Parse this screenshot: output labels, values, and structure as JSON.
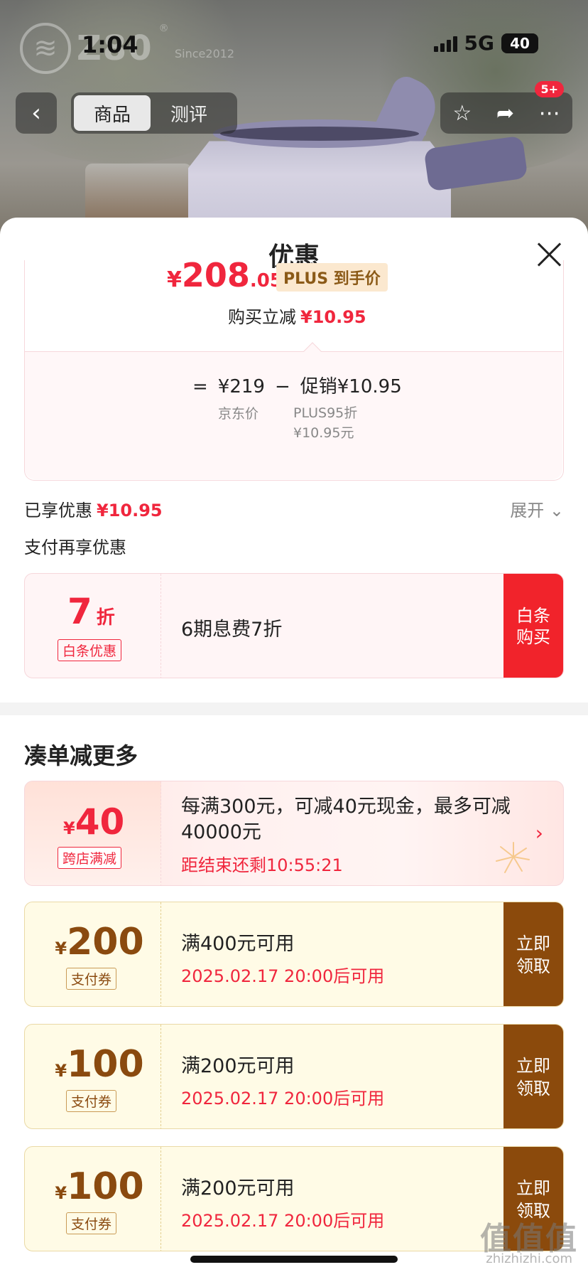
{
  "status_bar": {
    "time": "1:04",
    "network": "5G",
    "battery": "40"
  },
  "watermark": {
    "logo_text": "Z80",
    "since": "Since2012",
    "reg": "®"
  },
  "nav": {
    "tabs": [
      "商品",
      "测评"
    ],
    "active_tab": "商品",
    "badge": "5+",
    "icons": [
      "back-icon",
      "star-icon",
      "share-icon",
      "more-icon"
    ]
  },
  "sheet": {
    "title": "优惠",
    "price": {
      "yen": "¥",
      "int": "208",
      "dec": ".05",
      "tag": "PLUS 到手价"
    },
    "reduce": {
      "label": "购买立减",
      "value": "¥10.95"
    },
    "formula": {
      "eq": "=",
      "jd_price": "¥219",
      "minus": "−",
      "promo": "促销¥10.95",
      "jd_label": "京东价",
      "promo_detail_1": "PLUS95折",
      "promo_detail_2": "¥10.95元"
    },
    "enjoyed": {
      "label": "已享优惠",
      "value": "¥10.95",
      "expand": "展开"
    },
    "pay_title": "支付再享优惠",
    "baitiao": {
      "num": "7",
      "unit": "折",
      "tag": "白条优惠",
      "desc": "6期息费7折",
      "button": "白条购买"
    },
    "more_title": "凑单减更多",
    "cross_store": {
      "yen": "¥",
      "amount": "40",
      "tag": "跨店满减",
      "desc": "每满300元，可减40元现金，最多可减40000元",
      "timer": "距结束还剩10:55:21"
    },
    "coupons": [
      {
        "yen": "¥",
        "amount": "200",
        "tag": "支付券",
        "condition": "满400元可用",
        "date": "2025.02.17 20:00后可用",
        "button": "立即领取"
      },
      {
        "yen": "¥",
        "amount": "100",
        "tag": "支付券",
        "condition": "满200元可用",
        "date": "2025.02.17 20:00后可用",
        "button": "立即领取"
      },
      {
        "yen": "¥",
        "amount": "100",
        "tag": "支付券",
        "condition": "满200元可用",
        "date": "2025.02.17 20:00后可用",
        "button": "立即领取"
      }
    ]
  },
  "corner_watermark": {
    "main": "值值值",
    "sub": "zhizhizhi.com"
  },
  "colors": {
    "accent_red": "#f0263d",
    "coupon_brown": "#8b4a0c",
    "coupon_bg": "#fffbe6"
  }
}
